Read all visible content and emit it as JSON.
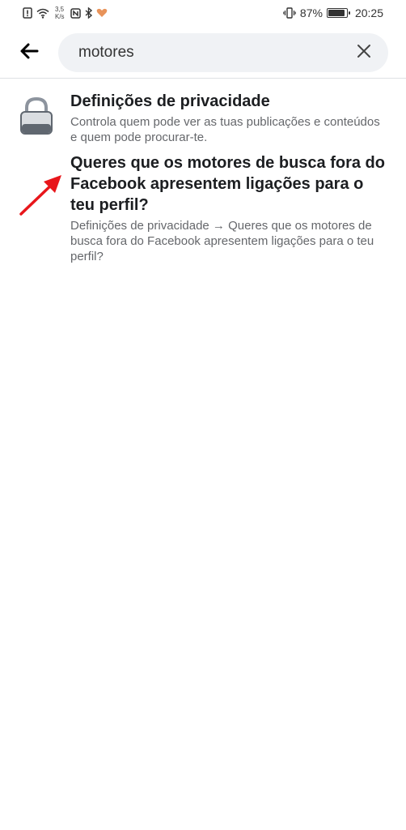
{
  "status_bar": {
    "speed_value": "3,5",
    "speed_unit": "K/s",
    "battery": "87%",
    "time": "20:25",
    "battery_level": 0.87
  },
  "search": {
    "query": "motores",
    "back_icon": "arrow-left-icon",
    "clear_icon": "close-icon"
  },
  "results": [
    {
      "icon": "lock-icon",
      "title": "Definições de privacidade",
      "description": "Controla quem pode ver as tuas publicações e conteúdos e quem pode procurar-te."
    },
    {
      "title": "Queres que os motores de busca fora do Facebook apresentem ligações para o teu perfil?",
      "description": "Definições de privacidade → Queres que os motores de busca fora do Facebook apresentem ligações para o teu perfil?"
    }
  ],
  "colors": {
    "search_bg": "#f0f2f5",
    "arrow_annotation": "#e8161b",
    "secondary_text": "#65676b"
  }
}
